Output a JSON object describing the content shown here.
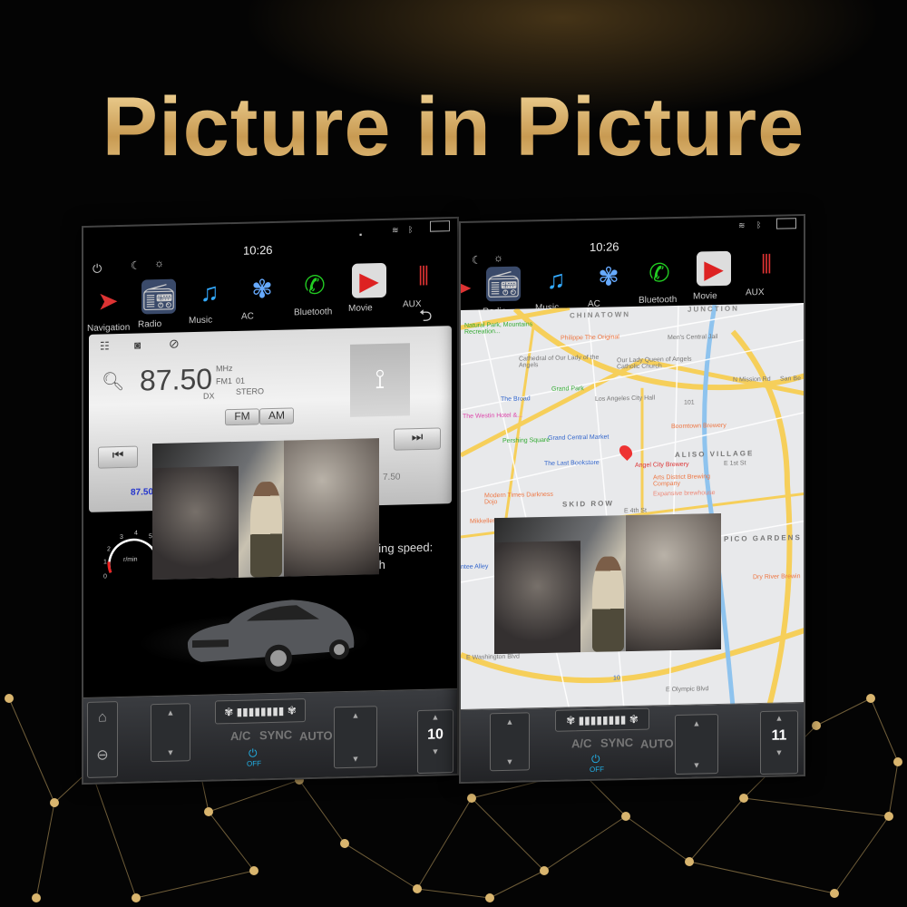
{
  "headline": "Picture in Picture",
  "colors": {
    "gold": "#d9b56e",
    "map_road": "#f6cf5a",
    "map_bg": "#e8e9eb",
    "river": "#8ec3ee",
    "off_blue": "#22b0e6"
  },
  "left_screen": {
    "status": {
      "time": "10:26",
      "icons": [
        "power-icon",
        "night-mode-icon",
        "brightness-icon",
        "sd-card-icon",
        "wifi-icon",
        "bluetooth-icon",
        "window-icon"
      ]
    },
    "apps": [
      {
        "label": "Navigation",
        "icon": "navigation-arrow-icon"
      },
      {
        "label": "Radio",
        "icon": "radio-icon"
      },
      {
        "label": "Music",
        "icon": "music-note-icon"
      },
      {
        "label": "AC",
        "icon": "fan-seat-icon"
      },
      {
        "label": "Bluetooth",
        "icon": "phone-icon"
      },
      {
        "label": "Movie",
        "icon": "play-icon"
      },
      {
        "label": "AUX",
        "icon": "rca-cable-icon"
      }
    ],
    "radio": {
      "frequency": "87.50",
      "unit": "MHz",
      "band": "FM1",
      "preset": "01",
      "mode": "STERO",
      "dx": "DX",
      "fm": "FM",
      "am": "AM",
      "preset_left": "87.50",
      "preset_right": "7.50"
    },
    "gauge": {
      "ticks": [
        "0",
        "1",
        "2",
        "3",
        "4",
        "5"
      ],
      "unit": "r/min"
    },
    "speed_text_1": "ning speed:",
    "speed_text_2": "/h",
    "climate": {
      "ac": "A/C",
      "sync": "SYNC",
      "auto": "AUTO",
      "power": "OFF",
      "temperature": "10"
    }
  },
  "right_screen": {
    "status": {
      "time": "10:26"
    },
    "apps": [
      {
        "label": "ion"
      },
      {
        "label": "Radio"
      },
      {
        "label": "Music"
      },
      {
        "label": "AC"
      },
      {
        "label": "Bluetooth"
      },
      {
        "label": "Movie"
      },
      {
        "label": "AUX"
      }
    ],
    "map_labels": [
      "CHINATOWN",
      "JUNCTION",
      "Natural Park, Mountains Recreation...",
      "Philippe The Original",
      "Men's Central Jail",
      "Cathedral of Our Lady of the Angels",
      "Our Lady Queen of Angels Catholic Church",
      "Grand Park",
      "The Broad",
      "Los Angeles City Hall",
      "N Mission Rd",
      "San Be",
      "The Westin Hotel &...",
      "Boomtown Brewery",
      "Grand Central Market",
      "Pershing Square",
      "ALISO VILLAGE",
      "The Last Bookstore",
      "Angel City Brewery",
      "E 1st St",
      "Arts District Brewing Company",
      "Expansive brewhouse",
      "Modern Times Darkness Dojo",
      "SKID ROW",
      "E 4th St",
      "Mikkeller DTLA",
      "PICO GARDENS",
      "Dry River Brewin",
      "ntee Alley",
      "E Washington Blvd",
      "E Olympic Blvd",
      "101",
      "10"
    ],
    "climate": {
      "ac": "A/C",
      "sync": "SYNC",
      "auto": "AUTO",
      "power": "OFF",
      "temperature": "11"
    }
  }
}
